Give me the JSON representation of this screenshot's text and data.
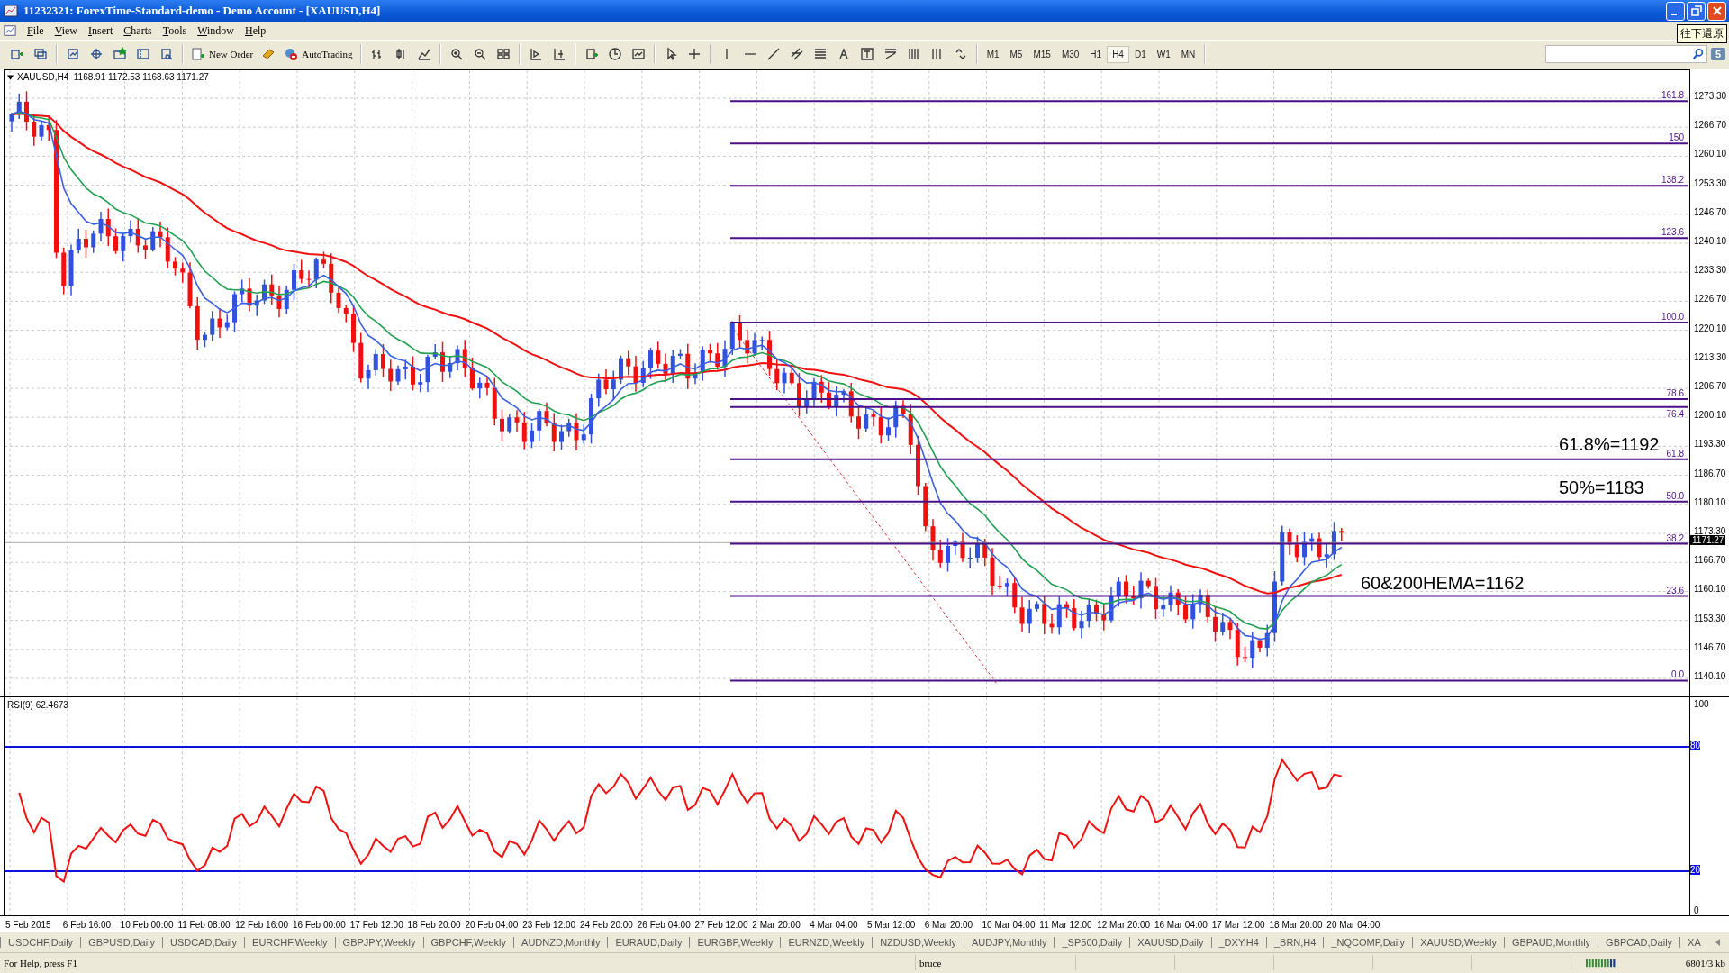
{
  "window": {
    "title": "11232321: ForexTime-Standard-demo - Demo Account - [XAUUSD,H4]",
    "tooltip": "往下還原"
  },
  "menu": [
    "File",
    "View",
    "Insert",
    "Charts",
    "Tools",
    "Window",
    "Help"
  ],
  "toolbar": {
    "new_order": "New Order",
    "autotrading": "AutoTrading",
    "messages_badge": "5",
    "timeframes": [
      {
        "label": "M1",
        "selected": false
      },
      {
        "label": "M5",
        "selected": false
      },
      {
        "label": "M15",
        "selected": false
      },
      {
        "label": "M30",
        "selected": false
      },
      {
        "label": "H1",
        "selected": false
      },
      {
        "label": "H4",
        "selected": true
      },
      {
        "label": "D1",
        "selected": false
      },
      {
        "label": "W1",
        "selected": false
      },
      {
        "label": "MN",
        "selected": false
      }
    ]
  },
  "chart": {
    "header": "XAUUSD,H4  1168.91 1172.53 1168.63 1171.27",
    "price_ticks": [
      "1273.30",
      "1266.70",
      "1260.10",
      "1253.30",
      "1246.70",
      "1240.10",
      "1233.30",
      "1226.70",
      "1220.10",
      "1213.30",
      "1206.70",
      "1200.10",
      "1193.30",
      "1186.70",
      "1180.10",
      "1173.30",
      "1166.70",
      "1160.10",
      "1153.30",
      "1146.70",
      "1140.10"
    ],
    "current_price": "1171.27",
    "fib_levels": [
      {
        "label": "161.8"
      },
      {
        "label": "150"
      },
      {
        "label": "138.2"
      },
      {
        "label": "123.6"
      },
      {
        "label": "100.0"
      },
      {
        "label": "78.6"
      },
      {
        "label": "76.4"
      },
      {
        "label": "61.8"
      },
      {
        "label": "50.0"
      },
      {
        "label": "38.2"
      },
      {
        "label": "23.6"
      },
      {
        "label": "0.0"
      }
    ],
    "annotations": [
      {
        "text": "61.8%=1192"
      },
      {
        "text": "50%=1183"
      },
      {
        "text": "60&200HEMA=1162"
      }
    ],
    "time_labels": [
      "5 Feb 2015",
      "6 Feb 16:00",
      "10 Feb 00:00",
      "11 Feb 08:00",
      "12 Feb 16:00",
      "16 Feb 00:00",
      "17 Feb 12:00",
      "18 Feb 20:00",
      "20 Feb 04:00",
      "23 Feb 12:00",
      "24 Feb 20:00",
      "26 Feb 04:00",
      "27 Feb 12:00",
      "2 Mar 20:00",
      "4 Mar 04:00",
      "5 Mar 12:00",
      "6 Mar 20:00",
      "10 Mar 04:00",
      "11 Mar 12:00",
      "12 Mar 20:00",
      "16 Mar 04:00",
      "17 Mar 12:00",
      "18 Mar 20:00",
      "20 Mar 04:00"
    ]
  },
  "rsi": {
    "label": "RSI(9) 62.4673",
    "scale": [
      "100",
      "80",
      "20",
      "0"
    ]
  },
  "symbol_tabs": [
    "USDCHF,Daily",
    "GBPUSD,Daily",
    "USDCAD,Daily",
    "EURCHF,Weekly",
    "GBPJPY,Weekly",
    "GBPCHF,Weekly",
    "AUDNZD,Monthly",
    "EURAUD,Daily",
    "EURGBP,Weekly",
    "EURNZD,Weekly",
    "NZDUSD,Weekly",
    "AUDJPY,Monthly",
    "_SP500,Daily",
    "XAUUSD,Daily",
    "_DXY,H4",
    "_BRN,H4",
    "_NQCOMP,Daily",
    "XAUUSD,Weekly",
    "GBPAUD,Monthly",
    "GBPCAD,Daily",
    "XA"
  ],
  "status_bar": {
    "help": "For Help, press F1",
    "profile": "bruce",
    "traffic": "6801/3 kb"
  }
}
